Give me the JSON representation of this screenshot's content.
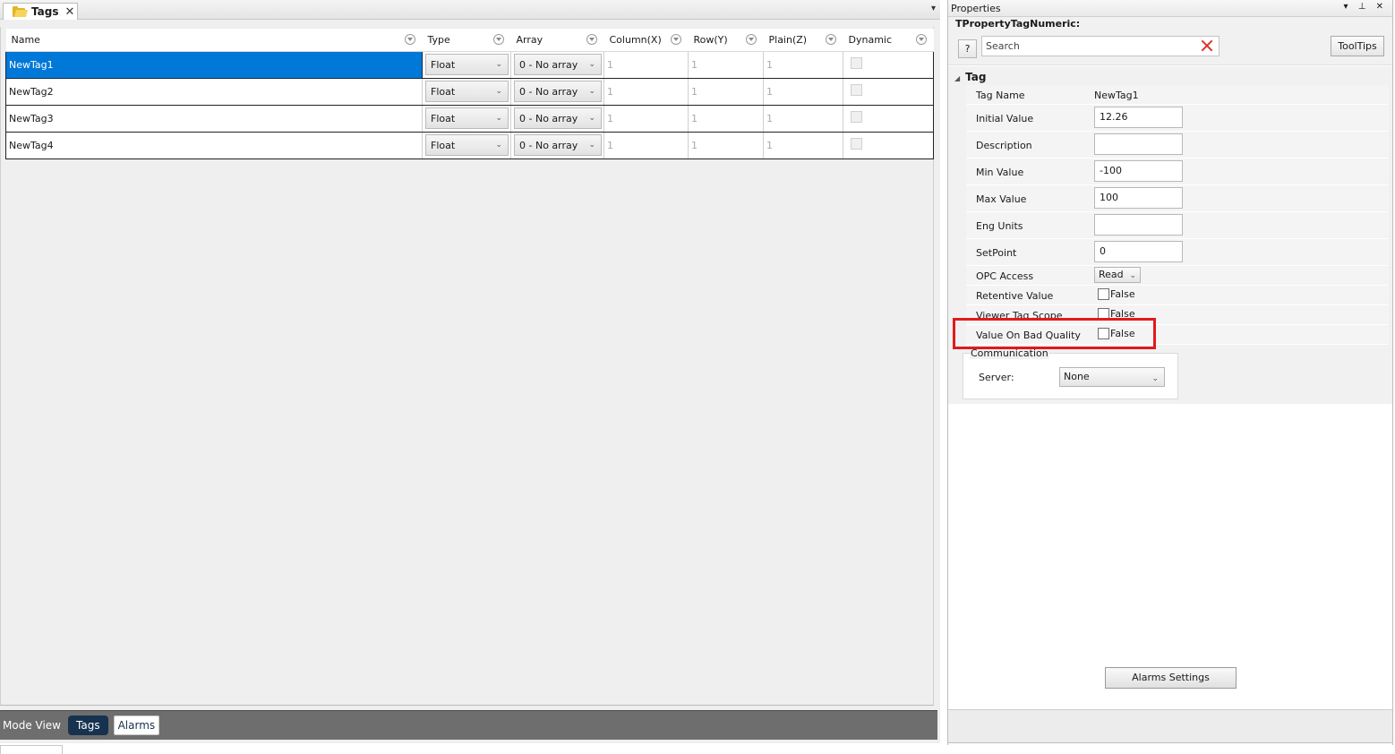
{
  "doc_tab": {
    "title": "Tags",
    "close": "✕"
  },
  "pane_pin": "▾",
  "grid": {
    "columns": [
      "Name",
      "Type",
      "Array",
      "Column(X)",
      "Row(Y)",
      "Plain(Z)",
      "Dynamic"
    ],
    "rows": [
      {
        "name": "NewTag1",
        "type": "Float",
        "array": "0 - No array",
        "col": "1",
        "row": "1",
        "plain": "1",
        "dynamic": false
      },
      {
        "name": "NewTag2",
        "type": "Float",
        "array": "0 - No array",
        "col": "1",
        "row": "1",
        "plain": "1",
        "dynamic": false
      },
      {
        "name": "NewTag3",
        "type": "Float",
        "array": "0 - No array",
        "col": "1",
        "row": "1",
        "plain": "1",
        "dynamic": false
      },
      {
        "name": "NewTag4",
        "type": "Float",
        "array": "0 - No array",
        "col": "1",
        "row": "1",
        "plain": "1",
        "dynamic": false
      }
    ],
    "selected_row": 0
  },
  "mode_view": {
    "label": "Mode View",
    "tags": "Tags",
    "alarms": "Alarms"
  },
  "properties": {
    "title": "Properties",
    "window_controls": "▾ ⊥ ✕",
    "class_name": "TPropertyTagNumeric:",
    "help": "?",
    "search_placeholder": "Search",
    "tooltips": "ToolTips",
    "group": "Tag",
    "tag_name_label": "Tag Name",
    "tag_name_value": "NewTag1",
    "initial_value_label": "Initial Value",
    "initial_value": "12.26",
    "description_label": "Description",
    "description": "",
    "min_value_label": "Min Value",
    "min_value": "-100",
    "max_value_label": "Max Value",
    "max_value": "100",
    "eng_units_label": "Eng Units",
    "eng_units": "",
    "setpoint_label": "SetPoint",
    "setpoint": "0",
    "opc_access_label": "OPC Access",
    "opc_access": "Read",
    "retentive_label": "Retentive Value",
    "retentive": "False",
    "viewer_scope_label": "Viewer Tag Scope",
    "viewer_scope": "False",
    "bad_quality_label": "Value On Bad Quality",
    "bad_quality": "False",
    "communication_label": "Communication",
    "server_label": "Server:",
    "server_value": "None",
    "alarms_settings": "Alarms Settings"
  },
  "colors": {
    "selection": "#0078d7",
    "highlight_box": "#e01b1b",
    "mode_active": "#16324f"
  }
}
